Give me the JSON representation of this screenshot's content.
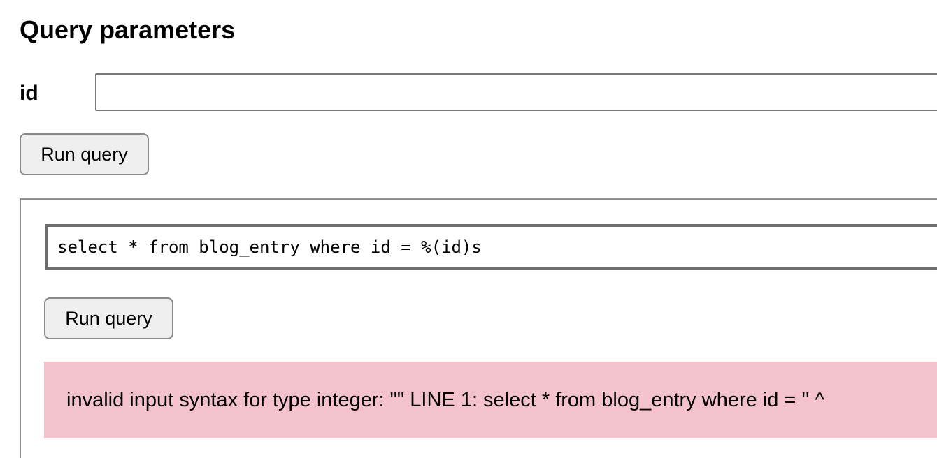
{
  "header": {
    "title": "Query parameters"
  },
  "params": {
    "id_label": "id",
    "id_value": ""
  },
  "actions": {
    "run_query_label": "Run query"
  },
  "sql": {
    "query": "select * from blog_entry where id = %(id)s",
    "run_query_label": "Run query"
  },
  "error": {
    "message": "invalid input syntax for type integer: \"\" LINE 1: select * from blog_entry where id = '' ^"
  },
  "colors": {
    "error_background": "#f4c2cc",
    "button_background": "#efefef"
  }
}
